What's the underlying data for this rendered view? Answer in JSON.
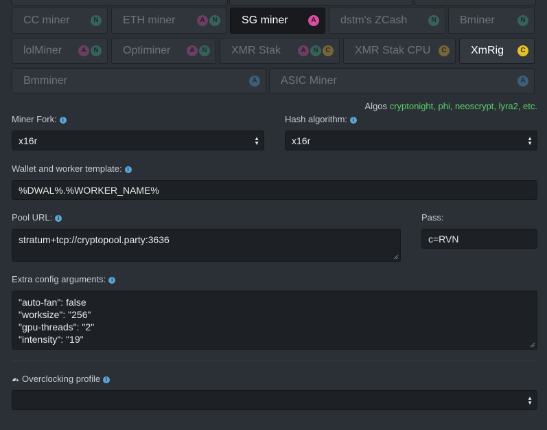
{
  "miners_row1": [
    {
      "label": "CC miner",
      "badges": [
        "N"
      ],
      "state": "light"
    },
    {
      "label": "ETH miner",
      "badges": [
        "A",
        "N"
      ],
      "state": "normal"
    },
    {
      "label": "SG miner",
      "badges": [
        "A"
      ],
      "state": "active"
    },
    {
      "label": "dstm's ZCash",
      "badges": [
        "N"
      ],
      "state": "normal"
    },
    {
      "label": "Bminer",
      "badges": [
        "N"
      ],
      "state": "normal"
    }
  ],
  "miners_row2": [
    {
      "label": "lolMiner",
      "badges": [
        "A",
        "N"
      ],
      "state": "normal"
    },
    {
      "label": "Optiminer",
      "badges": [
        "A",
        "N"
      ],
      "state": "normal"
    },
    {
      "label": "XMR Stak",
      "badges": [
        "A",
        "N",
        "C"
      ],
      "state": "normal"
    },
    {
      "label": "XMR Stak CPU",
      "badges": [
        "C"
      ],
      "state": "normal"
    },
    {
      "label": "XmRig",
      "badges": [
        "C"
      ],
      "state": "light"
    }
  ],
  "miners_row3": [
    {
      "label": "Bmminer",
      "badges": [
        "A"
      ],
      "state": "normal"
    },
    {
      "label": "ASIC Miner",
      "badges": [
        "A"
      ],
      "state": "normal"
    }
  ],
  "algos": {
    "prefix": "Algos",
    "list": "cryptonight, phi, neoscrypt, lyra2, etc."
  },
  "miner_fork": {
    "label": "Miner Fork:",
    "value": "x16r"
  },
  "hash_algorithm": {
    "label": "Hash algorithm:",
    "value": "x16r"
  },
  "wallet_template": {
    "label": "Wallet and worker template:",
    "value": "%DWAL%.%WORKER_NAME%"
  },
  "pool_url": {
    "label": "Pool URL:",
    "value": "stratum+tcp://cryptopool.party:3636"
  },
  "pass": {
    "label": "Pass:",
    "value": "c=RVN"
  },
  "extra_config": {
    "label": "Extra config arguments:",
    "lines": [
      "\"auto-fan\": false",
      "\"worksize\": \"256\"",
      "\"gpu-threads\": \"2\"",
      "\"intensity\": \"19\""
    ]
  },
  "overclocking": {
    "label": "Overclocking profile",
    "value": ""
  },
  "colors": {
    "accent_green": "#59d36b",
    "info_blue": "#5aa7d8",
    "badge_N": "#3bb89a",
    "badge_A": "#d54fa0",
    "badge_C": "#e6c229"
  }
}
